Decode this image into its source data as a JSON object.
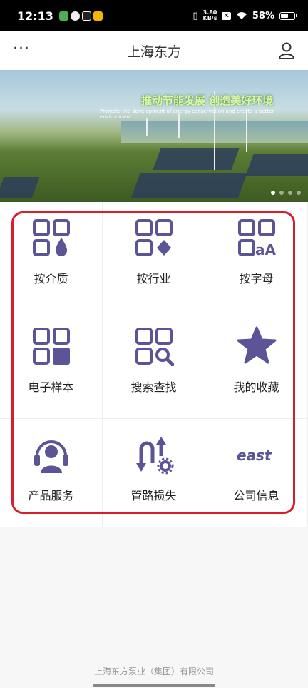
{
  "status_bar": {
    "time": "12:13",
    "speed_value": "3.80",
    "speed_unit": "KB/s",
    "battery": "58%"
  },
  "header": {
    "more_label": "···",
    "title": "上海东方"
  },
  "banner": {
    "slogan_cn": "推动节能发展 创造美好环境",
    "slogan_en": "Promote the development of energy conservation and create a better environment."
  },
  "grid": {
    "items": [
      {
        "label": "按介质",
        "icon": "grid-drop-icon"
      },
      {
        "label": "按行业",
        "icon": "grid-diamond-icon"
      },
      {
        "label": "按字母",
        "icon": "grid-letters-icon"
      },
      {
        "label": "电子样本",
        "icon": "grid-square-icon"
      },
      {
        "label": "搜索查找",
        "icon": "grid-search-icon"
      },
      {
        "label": "我的收藏",
        "icon": "star-icon"
      },
      {
        "label": "产品服务",
        "icon": "headset-icon"
      },
      {
        "label": "管路损失",
        "icon": "pipe-loss-icon"
      },
      {
        "label": "公司信息",
        "icon": "east-logo-icon"
      }
    ],
    "letters_glyph": "aA",
    "logo_text": "east"
  },
  "colors": {
    "icon": "#5b5496",
    "highlight": "#d81e2a"
  },
  "footer": {
    "company": "上海东方泵业（集团）有限公司"
  }
}
